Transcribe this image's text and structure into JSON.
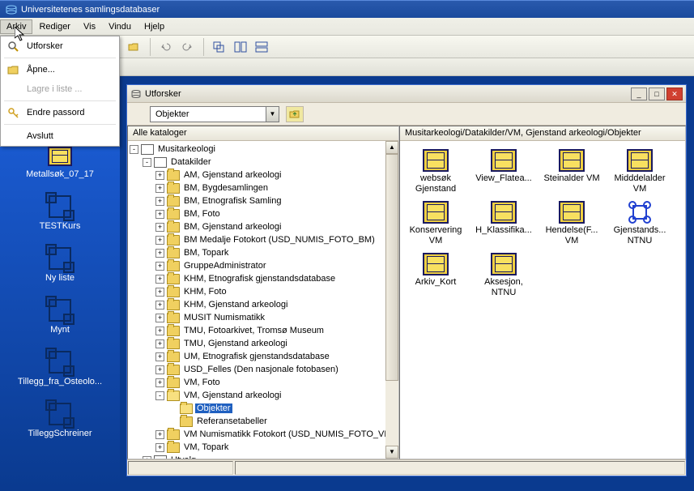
{
  "window": {
    "title": "Universitetenes samlingsdatabaser"
  },
  "menubar": [
    "Arkiv",
    "Rediger",
    "Vis",
    "Vindu",
    "Hjelp"
  ],
  "dropdown": {
    "items": [
      {
        "label": "Utforsker",
        "icon": "magnifier"
      },
      {
        "label": "Åpne...",
        "icon": "folder-open"
      },
      {
        "label": "Lagre i liste ...",
        "icon": "",
        "disabled": true
      },
      {
        "label": "Endre passord",
        "icon": "key"
      },
      {
        "label": "Avslutt",
        "icon": ""
      }
    ]
  },
  "sidebar": [
    {
      "label": "Metallsøk_07_17",
      "type": "cabinet"
    },
    {
      "label": "TESTKurs",
      "type": "geo"
    },
    {
      "label": "Ny liste",
      "type": "geo"
    },
    {
      "label": "Mynt",
      "type": "geo"
    },
    {
      "label": "Tillegg_fra_Osteolo...",
      "type": "geo"
    },
    {
      "label": "TilleggSchreiner",
      "type": "geo"
    }
  ],
  "explorer": {
    "title": "Utforsker",
    "combo": "Objekter",
    "tree_header": "Alle kataloger",
    "icon_header": "Musitarkeologi/Datakilder/VM, Gjenstand arkeologi/Objekter",
    "tree": [
      {
        "label": "Musitarkeologi",
        "indent": 0,
        "exp": "-",
        "icon": "db"
      },
      {
        "label": "Datakilder",
        "indent": 1,
        "exp": "-",
        "icon": "db"
      },
      {
        "label": "AM, Gjenstand arkeologi",
        "indent": 2,
        "exp": "+",
        "icon": "folder"
      },
      {
        "label": "BM, Bygdesamlingen",
        "indent": 2,
        "exp": "+",
        "icon": "folder"
      },
      {
        "label": "BM, Etnografisk Samling",
        "indent": 2,
        "exp": "+",
        "icon": "folder"
      },
      {
        "label": "BM, Foto",
        "indent": 2,
        "exp": "+",
        "icon": "folder"
      },
      {
        "label": "BM, Gjenstand arkeologi",
        "indent": 2,
        "exp": "+",
        "icon": "folder"
      },
      {
        "label": "BM Medalje Fotokort (USD_NUMIS_FOTO_BM)",
        "indent": 2,
        "exp": "+",
        "icon": "folder"
      },
      {
        "label": "BM, Topark",
        "indent": 2,
        "exp": "+",
        "icon": "folder"
      },
      {
        "label": "GruppeAdministrator",
        "indent": 2,
        "exp": "+",
        "icon": "folder"
      },
      {
        "label": "KHM, Etnografisk gjenstandsdatabase",
        "indent": 2,
        "exp": "+",
        "icon": "folder"
      },
      {
        "label": "KHM, Foto",
        "indent": 2,
        "exp": "+",
        "icon": "folder"
      },
      {
        "label": "KHM, Gjenstand arkeologi",
        "indent": 2,
        "exp": "+",
        "icon": "folder"
      },
      {
        "label": "MUSIT Numismatikk",
        "indent": 2,
        "exp": "+",
        "icon": "folder"
      },
      {
        "label": "TMU, Fotoarkivet, Tromsø Museum",
        "indent": 2,
        "exp": "+",
        "icon": "folder"
      },
      {
        "label": "TMU, Gjenstand arkeologi",
        "indent": 2,
        "exp": "+",
        "icon": "folder"
      },
      {
        "label": "UM, Etnografisk gjenstandsdatabase",
        "indent": 2,
        "exp": "+",
        "icon": "folder"
      },
      {
        "label": "USD_Felles (Den nasjonale fotobasen)",
        "indent": 2,
        "exp": "+",
        "icon": "folder"
      },
      {
        "label": "VM, Foto",
        "indent": 2,
        "exp": "+",
        "icon": "folder"
      },
      {
        "label": "VM, Gjenstand arkeologi",
        "indent": 2,
        "exp": "-",
        "icon": "folder-open"
      },
      {
        "label": "Objekter",
        "indent": 3,
        "exp": "",
        "icon": "folder-open",
        "selected": true
      },
      {
        "label": "Referansetabeller",
        "indent": 3,
        "exp": "",
        "icon": "folder"
      },
      {
        "label": "VM Numismatikk Fotokort (USD_NUMIS_FOTO_VM)",
        "indent": 2,
        "exp": "+",
        "icon": "folder"
      },
      {
        "label": "VM, Topark",
        "indent": 2,
        "exp": "+",
        "icon": "folder"
      },
      {
        "label": "Utvalg",
        "indent": 1,
        "exp": "+",
        "icon": "db"
      }
    ],
    "icons": [
      {
        "label": "websøk Gjenstand",
        "type": "cabinet"
      },
      {
        "label": "View_Flatea...",
        "type": "cabinet"
      },
      {
        "label": "Steinalder VM",
        "type": "cabinet"
      },
      {
        "label": "Midddelalder VM",
        "type": "cabinet"
      },
      {
        "label": "Konservering VM",
        "type": "cabinet"
      },
      {
        "label": "H_Klassifika...",
        "type": "cabinet"
      },
      {
        "label": "Hendelse(F... VM",
        "type": "cabinet"
      },
      {
        "label": "Gjenstands... NTNU",
        "type": "bluegeo"
      },
      {
        "label": "Arkiv_Kort",
        "type": "cabinet"
      },
      {
        "label": "Aksesjon, NTNU",
        "type": "cabinet"
      }
    ]
  }
}
